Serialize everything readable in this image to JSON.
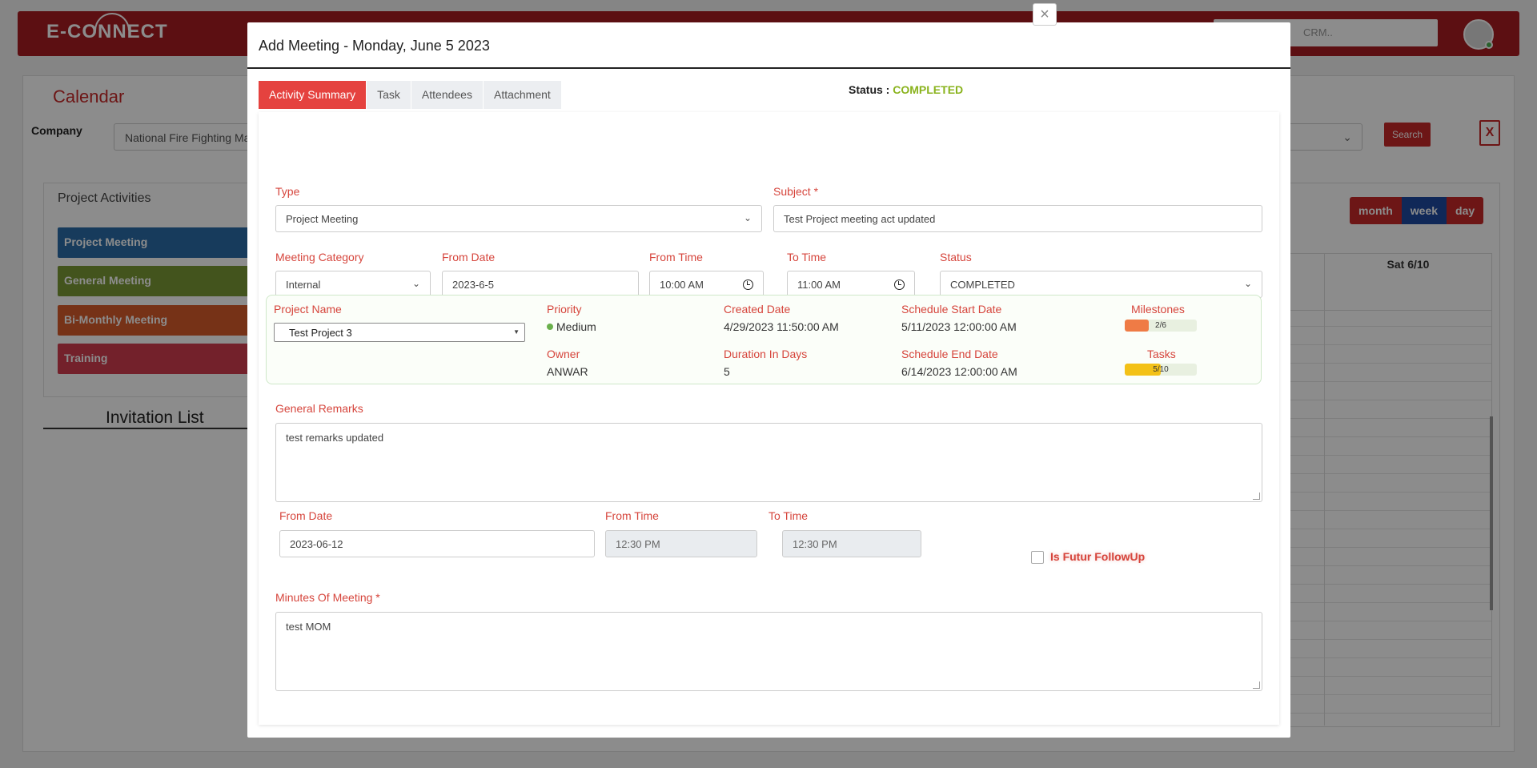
{
  "app": {
    "logo_text": "E-CONNECT",
    "search_placeholder": "CRM..",
    "page_title": "Calendar",
    "company_label": "Company",
    "company_value": "National Fire Fighting Ma",
    "search_button": "Search",
    "xls_icon": "X"
  },
  "activities": {
    "title": "Project Activities",
    "items": [
      {
        "label": "Project Meeting",
        "color": "#2b6ca8"
      },
      {
        "label": "General Meeting",
        "color": "#7a9a35"
      },
      {
        "label": "Bi-Monthly Meeting",
        "color": "#d85b2a"
      },
      {
        "label": "Training",
        "color": "#d13c4f"
      }
    ],
    "invitation_title": "Invitation List"
  },
  "calendar": {
    "views": [
      "month",
      "week",
      "day"
    ],
    "active_view": "week",
    "day_header": "Sat 6/10"
  },
  "modal": {
    "title": "Add Meeting - Monday, June 5 2023",
    "close": "×",
    "tabs": [
      "Activity Summary",
      "Task",
      "Attendees",
      "Attachment"
    ],
    "active_tab": "Activity Summary",
    "status_label": "Status",
    "status_separator": " : ",
    "status_value": "COMPLETED",
    "form": {
      "type_label": "Type",
      "type_value": "Project Meeting",
      "subject_label": "Subject *",
      "subject_value": "Test Project meeting act updated",
      "category_label": "Meeting Category",
      "category_value": "Internal",
      "from_date_label": "From Date",
      "from_date_value": "2023-6-5",
      "from_time_label": "From Time",
      "from_time_value": "10:00  AM",
      "to_time_label": "To Time",
      "to_time_value": "11:00  AM",
      "status_label": "Status",
      "status_value": "COMPLETED"
    },
    "project": {
      "name_label": "Project Name",
      "name_value": "Test Project 3",
      "priority_label": "Priority",
      "priority_value": "Medium",
      "created_label": "Created Date",
      "created_value": "4/29/2023 11:50:00 AM",
      "sched_start_label": "Schedule Start Date",
      "sched_start_value": "5/11/2023 12:00:00 AM",
      "milestones_label": "Milestones",
      "milestones_text": "2/6",
      "milestones_fraction": 0.333,
      "owner_label": "Owner",
      "owner_value": "ANWAR",
      "duration_label": "Duration In Days",
      "duration_value": "5",
      "sched_end_label": "Schedule End Date",
      "sched_end_value": "6/14/2023 12:00:00 AM",
      "tasks_label": "Tasks",
      "tasks_text": "5/10",
      "tasks_fraction": 0.5
    },
    "remarks_label": "General Remarks",
    "remarks_value": "test remarks updated",
    "followup": {
      "from_date_label": "From Date",
      "from_date_value": "2023-06-12",
      "from_time_label": "From Time",
      "from_time_value": "12:30 PM",
      "to_time_label": "To Time",
      "to_time_value": "12:30 PM",
      "checkbox_label": "Is Futur FollowUp"
    },
    "mom_label": "Minutes Of Meeting *",
    "mom_value": "test MOM"
  }
}
